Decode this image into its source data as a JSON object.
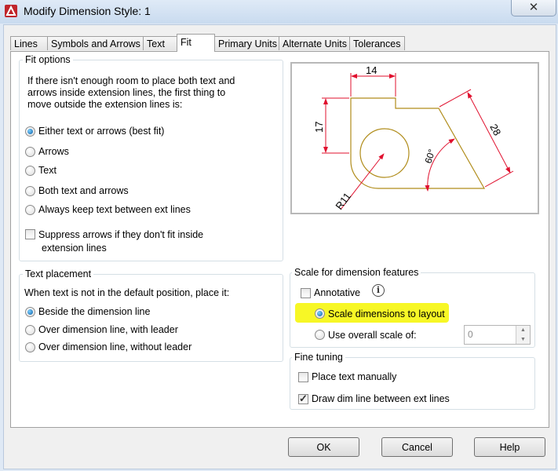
{
  "window": {
    "title": "Modify Dimension Style: 1",
    "close_glyph": "✕"
  },
  "tabs": [
    {
      "label": "Lines"
    },
    {
      "label": "Symbols and Arrows"
    },
    {
      "label": "Text"
    },
    {
      "label": "Fit"
    },
    {
      "label": "Primary Units"
    },
    {
      "label": "Alternate Units"
    },
    {
      "label": "Tolerances"
    }
  ],
  "fit_options": {
    "title": "Fit options",
    "description": "If there isn't enough room to place both text and arrows inside extension lines, the first thing to move outside the extension lines is:",
    "options": [
      {
        "label": "Either text or arrows (best fit)",
        "selected": true
      },
      {
        "label": "Arrows",
        "selected": false
      },
      {
        "label": "Text",
        "selected": false
      },
      {
        "label": "Both text and arrows",
        "selected": false
      },
      {
        "label": "Always keep text between ext lines",
        "selected": false
      }
    ],
    "suppress_line1": "Suppress arrows if they don't fit inside",
    "suppress_line2": "extension lines",
    "suppress_checked": false
  },
  "text_placement": {
    "title": "Text placement",
    "description": "When text is not in the default position, place it:",
    "options": [
      {
        "label": "Beside the dimension line",
        "selected": true
      },
      {
        "label": "Over dimension line, with leader",
        "selected": false
      },
      {
        "label": "Over dimension line, without leader",
        "selected": false
      }
    ]
  },
  "preview": {
    "dim_top": "14",
    "dim_left": "17",
    "dim_diagonal": "28",
    "dim_angle": "60°",
    "dim_radius": "R11"
  },
  "scale": {
    "title": "Scale for dimension features",
    "annotative_label": "Annotative",
    "annotative_checked": false,
    "scale_to_layout_label": "Scale dimensions to layout",
    "scale_to_layout_selected": true,
    "overall_scale_label": "Use overall scale of:",
    "overall_scale_selected": false,
    "overall_scale_value": "0"
  },
  "fine_tuning": {
    "title": "Fine tuning",
    "place_manually_label": "Place text manually",
    "place_manually_checked": false,
    "draw_dim_line_label": "Draw dim line between ext lines",
    "draw_dim_line_checked": true
  },
  "buttons": {
    "ok": "OK",
    "cancel": "Cancel",
    "help": "Help"
  },
  "colors": {
    "preview_geometry": "#b08c1a",
    "dimension_lines": "#e0102e",
    "highlight": "#f7f726"
  }
}
